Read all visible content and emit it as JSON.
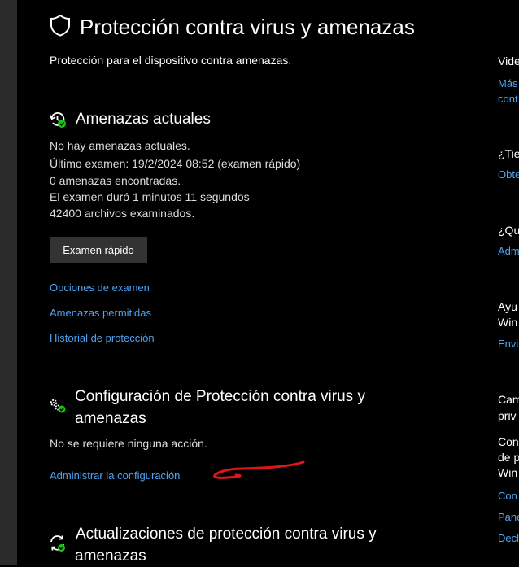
{
  "header": {
    "title": "Protección contra virus y amenazas",
    "subtitle": "Protección para el dispositivo contra amenazas."
  },
  "current_threats": {
    "title": "Amenazas actuales",
    "lines": [
      "No hay amenazas actuales.",
      "Último examen: 19/2/2024 08:52 (examen rápido)",
      "0 amenazas encontradas.",
      "El examen duró 1 minutos 11 segundos",
      "42400 archivos examinados."
    ],
    "button_label": "Examen rápido",
    "links": [
      "Opciones de examen",
      "Amenazas permitidas",
      "Historial de protección"
    ]
  },
  "settings": {
    "title_line1": "Configuración de Protección contra virus y",
    "title_line2": "amenazas",
    "status": "No se requiere ninguna acción.",
    "link": "Administrar la configuración"
  },
  "updates": {
    "title_line1": "Actualizaciones de protección contra virus y",
    "title_line2": "amenazas"
  },
  "right_panel": {
    "texts": [
      "Vide",
      "¿Tie",
      "¿Qu",
      "Ayu",
      "Win",
      "Cam",
      "priv",
      "Con",
      "de p",
      "Win"
    ],
    "links": [
      "Más",
      "cont",
      "Obte",
      "Adm",
      "Envi",
      "Con",
      "Pane",
      "Decl"
    ]
  },
  "colors": {
    "background": "#000000",
    "link": "#4ea3f1",
    "button": "#333333",
    "status_ok": "#16c60c",
    "annotation": "#e0141b"
  }
}
